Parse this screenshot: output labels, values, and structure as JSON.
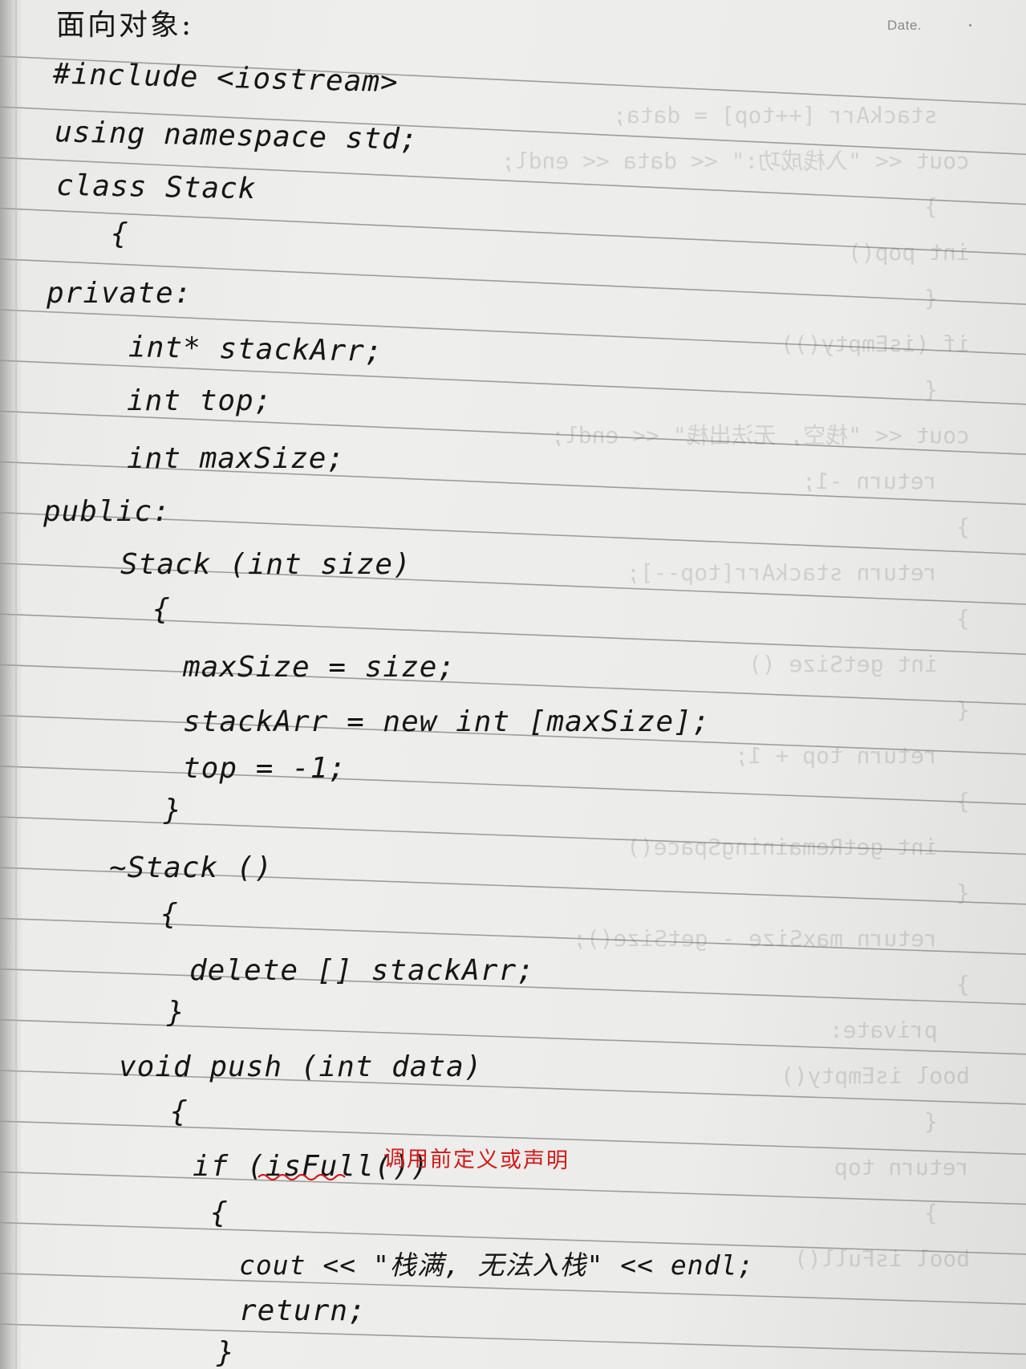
{
  "header": {
    "date_label": "Date."
  },
  "notes": {
    "title": "面向对象:",
    "lines": [
      "#include <iostream>",
      "using namespace std;",
      "class Stack",
      "{",
      "private:",
      "int* stackArr;",
      "int top;",
      "int maxSize;",
      "public:",
      "Stack (int size)",
      "{",
      "maxSize = size;",
      "stackArr = new int [maxSize];",
      "top = -1;",
      "}",
      "~Stack ()",
      "{",
      "delete [] stackArr;",
      "}",
      "void push (int data)",
      "{",
      "if (isFull())",
      "{",
      "cout << \"栈满, 无法入栈\" << endl;",
      "return;",
      "}"
    ],
    "annotation": "调用前定义或声明"
  },
  "bleed_through": {
    "lines": [
      "stackArr [++top] = data;",
      "cout << \"入栈成功:\" << data << endl;",
      "}",
      "int pop()",
      "{",
      "if (isEmpty())",
      "{",
      "cout << \"栈空, 无法出栈\" << endl;",
      "return -1;",
      "}",
      "return stackArr[top--];",
      "}",
      "int getSize ()",
      "{",
      "return top + 1;",
      "}",
      "int getRemainingSpace()",
      "{",
      "return maxSize - getSize();",
      "}",
      "private:",
      "bool isEmpty()",
      "{",
      "return top",
      "}",
      "bool isFull()"
    ]
  }
}
